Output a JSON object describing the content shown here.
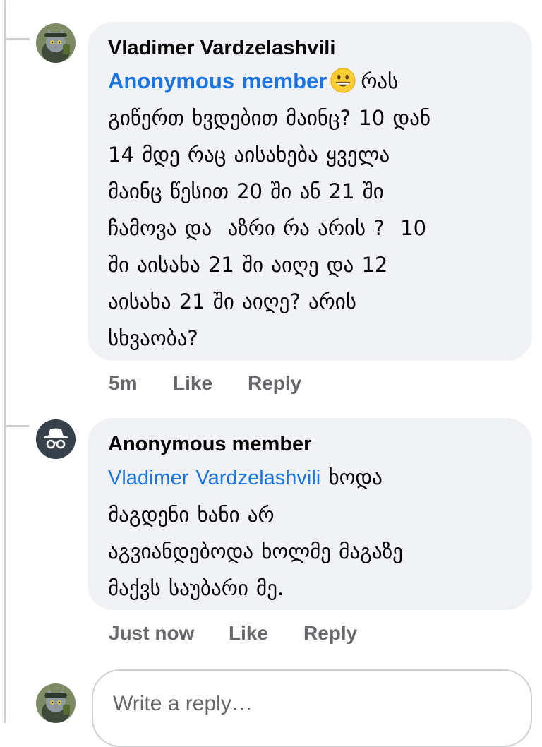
{
  "comments": [
    {
      "author": "Vladimer Vardzelashvili",
      "tag": "Anonymous member",
      "emoji": "grinning-face-emoji",
      "text_lines": [
        "რას",
        "გიწერთ ხვდებით მაინც? 10 დან",
        "14 მდე რაც აისახება ყველა",
        "მაინც წესით 20 ში ან 21 ში",
        "ჩამოვა და  აზრი რა არის ?  10",
        "ში აისახა 21 ში აიღე და 12",
        "აისახა 21 ში აიღე? არის",
        "სხვაობა?"
      ],
      "time": "5m",
      "like_label": "Like",
      "reply_label": "Reply"
    },
    {
      "author": "Anonymous member",
      "tag": "Vladimer Vardzelashvili",
      "text_lines": [
        "ხოდა",
        "მაგდენი ხანი არ",
        "აგვიანდებოდა ხოლმე მაგაზე",
        "მაქვს საუბარი მე."
      ],
      "time": "Just now",
      "like_label": "Like",
      "reply_label": "Reply"
    }
  ],
  "reply_box": {
    "placeholder": "Write a reply…"
  },
  "colors": {
    "link": "#1b74e4",
    "bubble": "#f0f2f5",
    "meta": "#65676b",
    "thread_line": "#ced0d4"
  }
}
